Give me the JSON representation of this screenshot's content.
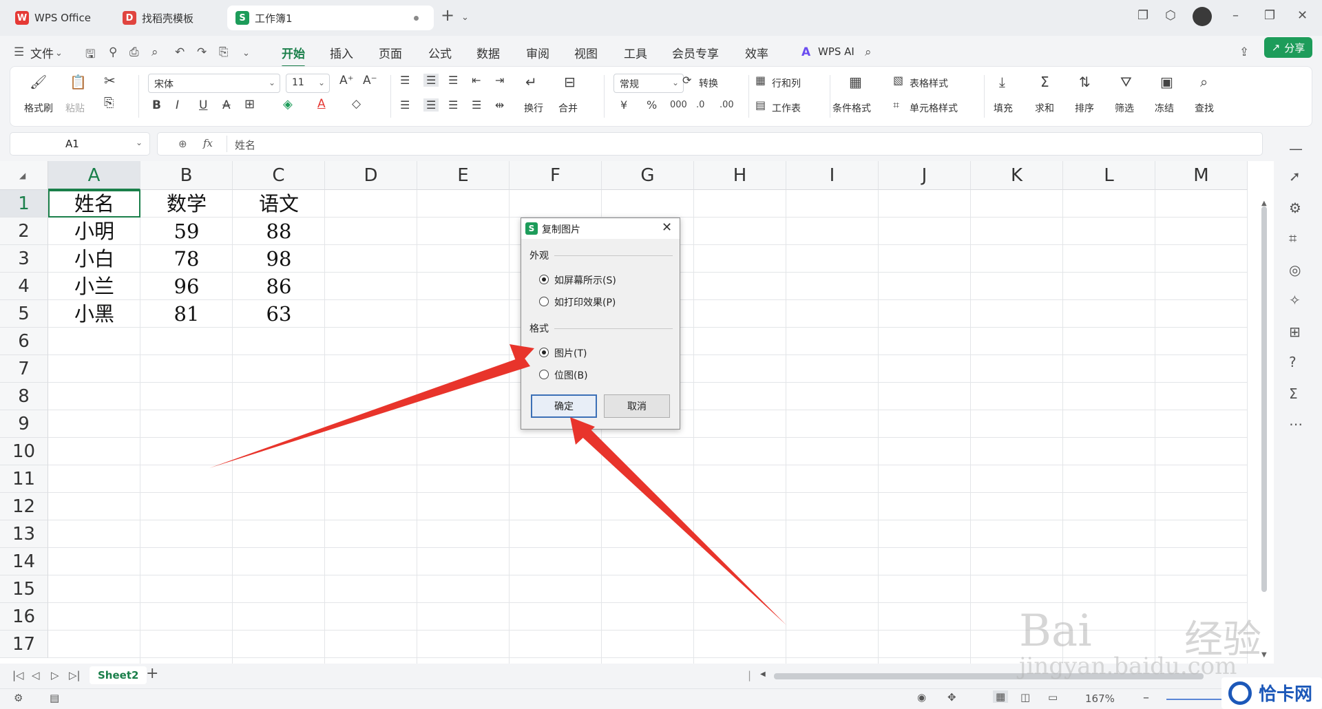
{
  "tabs": [
    {
      "label": "WPS Office"
    },
    {
      "label": "找稻壳模板"
    },
    {
      "label": "工作簿1"
    }
  ],
  "menu": {
    "file": "文件",
    "items": [
      "开始",
      "插入",
      "页面",
      "公式",
      "数据",
      "审阅",
      "视图",
      "工具",
      "会员专享",
      "效率"
    ],
    "active": "开始",
    "wps_ai": "WPS AI",
    "share": "分享"
  },
  "ribbon": {
    "format_painter": "格式刷",
    "paste": "粘贴",
    "font_name": "宋体",
    "font_size": "11",
    "wrap": "换行",
    "merge": "合并",
    "number_format": "常规",
    "convert": "转换",
    "row_col": "行和列",
    "worksheet": "工作表",
    "cond_format": "条件格式",
    "table_style": "表格样式",
    "cell_style": "单元格样式",
    "fill": "填充",
    "sum": "求和",
    "sort": "排序",
    "filter": "筛选",
    "freeze": "冻结",
    "find": "查找"
  },
  "formula_bar": {
    "name_box": "A1",
    "fx": "fx",
    "content": "姓名"
  },
  "grid": {
    "columns": [
      "A",
      "B",
      "C",
      "D",
      "E",
      "F",
      "G",
      "H",
      "I",
      "J",
      "K",
      "L",
      "M"
    ],
    "rows": [
      "1",
      "2",
      "3",
      "4",
      "5",
      "6",
      "7",
      "8",
      "9",
      "10",
      "11",
      "12",
      "13",
      "14",
      "15",
      "16",
      "17"
    ],
    "cells": [
      [
        "姓名",
        "数学",
        "语文"
      ],
      [
        "小明",
        "59",
        "88"
      ],
      [
        "小白",
        "78",
        "98"
      ],
      [
        "小兰",
        "96",
        "86"
      ],
      [
        "小黑",
        "81",
        "63"
      ]
    ]
  },
  "sheet": {
    "name": "Sheet2"
  },
  "status": {
    "zoom": "167%"
  },
  "dialog": {
    "title": "复制图片",
    "appearance_label": "外观",
    "opt_screen": "如屏幕所示(S)",
    "opt_print": "如打印效果(P)",
    "format_label": "格式",
    "opt_picture": "图片(T)",
    "opt_bitmap": "位图(B)",
    "ok": "确定",
    "cancel": "取消"
  },
  "watermark": {
    "brand": "Bai",
    "brand2": "经验",
    "url": "jingyan.baidu.com",
    "corner": "恰卡网"
  },
  "colors": {
    "accent": "#1a7f4a",
    "arrow": "#e8342b"
  }
}
